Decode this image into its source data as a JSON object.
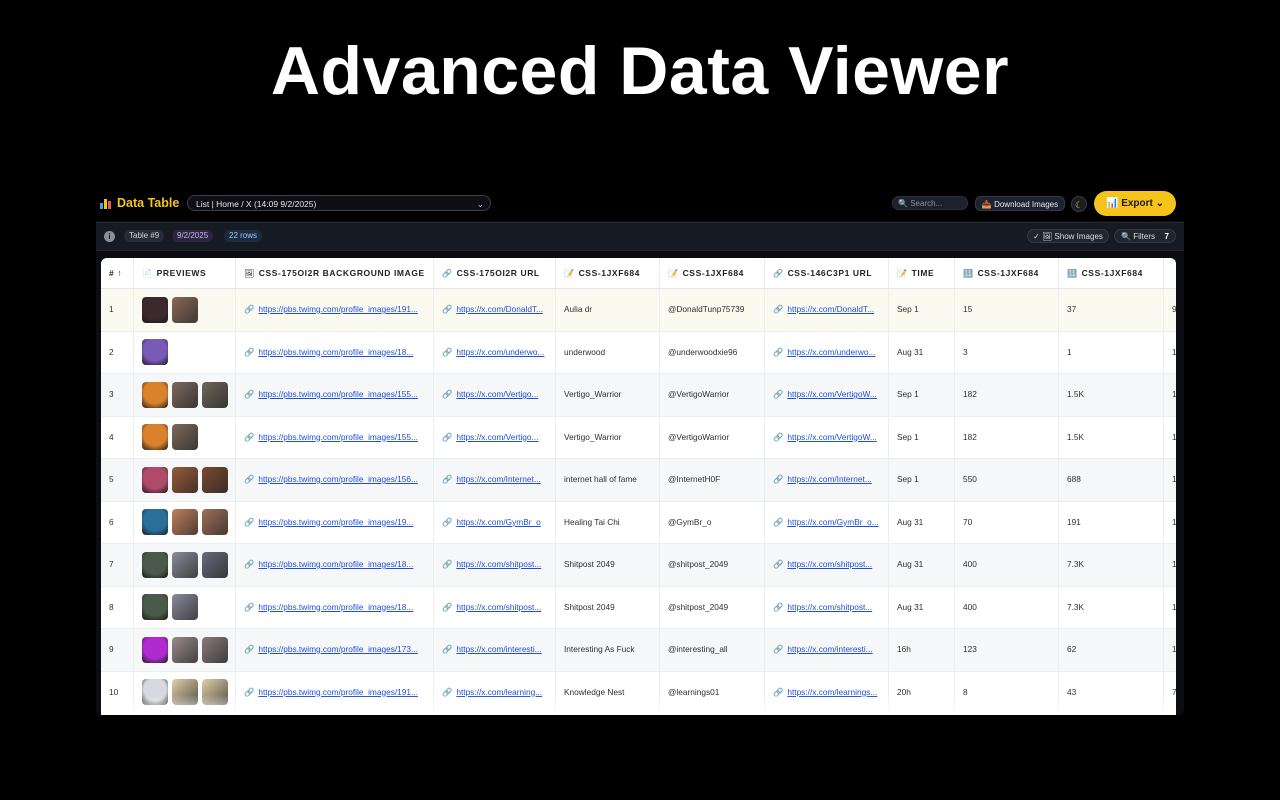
{
  "hero": {
    "title": "Advanced Data Viewer"
  },
  "topbar": {
    "brand": "Data Table",
    "view_select": "List | Home / X (14:09 9/2/2025)",
    "search_placeholder": "Search...",
    "download_label": "Download Images",
    "export_label": "Export"
  },
  "infobar": {
    "table": "Table #9",
    "date": "9/2/2025",
    "rows": "22 rows",
    "show_images": "Show Images",
    "filters": "Filters",
    "filters_count": "7"
  },
  "columns": [
    {
      "label": "# ↑",
      "icon": ""
    },
    {
      "label": "PREVIEWS",
      "icon": "📄"
    },
    {
      "label": "CSS-175OI2R BACKGROUND IMAGE",
      "icon": "🖼"
    },
    {
      "label": "CSS-175OI2R URL",
      "icon": "🔗"
    },
    {
      "label": "CSS-1JXF684",
      "icon": "📝"
    },
    {
      "label": "CSS-1JXF684",
      "icon": "📝"
    },
    {
      "label": "CSS-146C3P1 URL",
      "icon": "🔗"
    },
    {
      "label": "TIME",
      "icon": "📝"
    },
    {
      "label": "CSS-1JXF684",
      "icon": "🔢"
    },
    {
      "label": "CSS-1JXF684",
      "icon": "🔢"
    },
    {
      "label": "",
      "icon": ""
    }
  ],
  "rows": [
    {
      "num": "1",
      "bg": "https://pbs.twimg.com/profile_images/191...",
      "url": "https://x.com/DonaldT...",
      "name": "Aulia dr",
      "handle": "@DonaldTunp75739",
      "url2": "https://x.com/DonaldT...",
      "time": "Sep 1",
      "c1": "15",
      "c2": "37",
      "c3": "9",
      "thumbs": [
        "#3a2a2e",
        "#8a6a5a"
      ]
    },
    {
      "num": "2",
      "bg": "https://pbs.twimg.com/profile_images/18...",
      "url": "https://x.com/underwo...",
      "name": "underwood",
      "handle": "@underwoodxie96",
      "url2": "https://x.com/underwo...",
      "time": "Aug 31",
      "c1": "3",
      "c2": "1",
      "c3": "1",
      "thumbs": [
        "#7a5ab8"
      ]
    },
    {
      "num": "3",
      "bg": "https://pbs.twimg.com/profile_images/155...",
      "url": "https://x.com/Vertigo...",
      "name": "Vertigo_Warrior",
      "handle": "@VertigoWarrior",
      "url2": "https://x.com/VertigoW...",
      "time": "Sep 1",
      "c1": "182",
      "c2": "1.5K",
      "c3": "1",
      "thumbs": [
        "#d9822b",
        "#7b6a5d",
        "#6e6658"
      ]
    },
    {
      "num": "4",
      "bg": "https://pbs.twimg.com/profile_images/155...",
      "url": "https://x.com/Vertigo...",
      "name": "Vertigo_Warrior",
      "handle": "@VertigoWarrior",
      "url2": "https://x.com/VertigoW...",
      "time": "Sep 1",
      "c1": "182",
      "c2": "1.5K",
      "c3": "1",
      "thumbs": [
        "#d9822b",
        "#7b6a5d"
      ]
    },
    {
      "num": "5",
      "bg": "https://pbs.twimg.com/profile_images/156...",
      "url": "https://x.com/Internet...",
      "name": "internet hall of fame",
      "handle": "@InternetH0F",
      "url2": "https://x.com/Internet...",
      "time": "Sep 1",
      "c1": "550",
      "c2": "688",
      "c3": "1",
      "thumbs": [
        "#b04a6a",
        "#9a5a3a",
        "#7a4a30"
      ]
    },
    {
      "num": "6",
      "bg": "https://pbs.twimg.com/profile_images/19...",
      "url": "https://x.com/GymBr_o",
      "name": "Healing Tai Chi",
      "handle": "@GymBr_o",
      "url2": "https://x.com/GymBr_o...",
      "time": "Aug 31",
      "c1": "70",
      "c2": "191",
      "c3": "1",
      "thumbs": [
        "#2a6f9a",
        "#c0805a",
        "#a0705a"
      ]
    },
    {
      "num": "7",
      "bg": "https://pbs.twimg.com/profile_images/18...",
      "url": "https://x.com/shitpost...",
      "name": "Shitpost 2049",
      "handle": "@shitpost_2049",
      "url2": "https://x.com/shitpost...",
      "time": "Aug 31",
      "c1": "400",
      "c2": "7.3K",
      "c3": "1",
      "thumbs": [
        "#4a5a4a",
        "#8a8a9a",
        "#6a6a7a"
      ]
    },
    {
      "num": "8",
      "bg": "https://pbs.twimg.com/profile_images/18...",
      "url": "https://x.com/shitpost...",
      "name": "Shitpost 2049",
      "handle": "@shitpost_2049",
      "url2": "https://x.com/shitpost...",
      "time": "Aug 31",
      "c1": "400",
      "c2": "7.3K",
      "c3": "1",
      "thumbs": [
        "#4a5a4a",
        "#8a8a9a"
      ]
    },
    {
      "num": "9",
      "bg": "https://pbs.twimg.com/profile_images/173...",
      "url": "https://x.com/interesti...",
      "name": "Interesting As Fuck",
      "handle": "@interesting_all",
      "url2": "https://x.com/interesti...",
      "time": "16h",
      "c1": "123",
      "c2": "62",
      "c3": "1",
      "thumbs": [
        "#b02ad0",
        "#9a8a8a",
        "#8a7a7a"
      ]
    },
    {
      "num": "10",
      "bg": "https://pbs.twimg.com/profile_images/191...",
      "url": "https://x.com/learning...",
      "name": "Knowledge Nest",
      "handle": "@learnings01",
      "url2": "https://x.com/learnings...",
      "time": "20h",
      "c1": "8",
      "c2": "43",
      "c3": "7",
      "thumbs": [
        "#d8d8e0",
        "#e0d0a8",
        "#e0d0a8"
      ]
    },
    {
      "num": "",
      "bg": "",
      "url": "",
      "name": "",
      "handle": "",
      "url2": "",
      "time": "",
      "c1": "",
      "c2": "",
      "c3": "",
      "thumbs": [
        "#cfd4e0",
        "#4a6ac0",
        "#3a5ab0"
      ]
    }
  ]
}
